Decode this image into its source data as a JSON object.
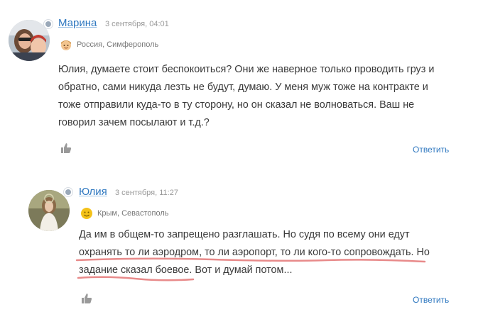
{
  "comments": [
    {
      "author": "Марина",
      "date": "3 сентября, 04:01",
      "location": "Россия, Симферополь",
      "location_icon": "child-face-icon",
      "lines": [
        "Юлия, думаете стоит беспокоиться? Они же наверное только проводить груз и",
        "обратно, сами никуда лезть не будут, думаю. У меня муж тоже на контракте и",
        "тоже отправили куда-то в ту сторону, но он сказал не волноваться. Ваш не",
        "говорил зачем посылают и т.д.?"
      ],
      "reply_label": "Ответить"
    },
    {
      "author": "Юлия",
      "date": "3 сентября, 11:27",
      "location": "Крым, Севастополь",
      "location_icon": "smiley-icon",
      "lines": [
        "Да им в общем-то запрещено разглашать. Но судя по всему они едут",
        "охранять то ли аэродром, то ли аэропорт, то ли кого-то сопровождать. Но",
        "задание сказал боевое. Вот и думай потом..."
      ],
      "reply_label": "Ответить"
    }
  ],
  "colors": {
    "link": "#2f78c0",
    "meta": "#999999",
    "text": "#3a3a3a",
    "underline_marker": "#e88a8a"
  }
}
